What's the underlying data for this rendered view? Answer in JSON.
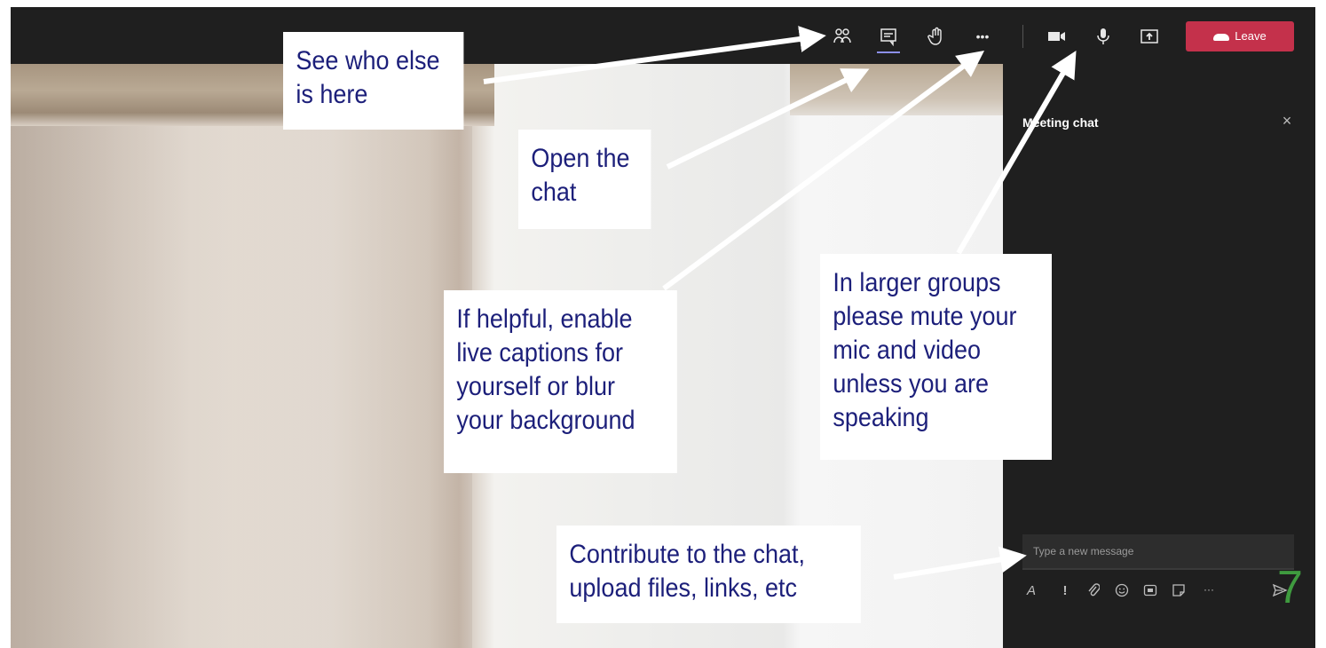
{
  "toolbar": {
    "icons": {
      "participants": "people-icon",
      "chat": "chat-icon",
      "raise_hand": "hand-icon",
      "more": "more-icon",
      "camera": "camera-icon",
      "microphone": "mic-icon",
      "share": "share-tray-icon"
    },
    "more_glyph": "•••",
    "leave_label": "Leave",
    "leave_color": "#c4314b",
    "active_underline_color": "#8c8fe8"
  },
  "chat_panel": {
    "title": "Meeting chat",
    "close_glyph": "×",
    "message_placeholder": "Type a new message",
    "composer_icons": [
      "format-icon",
      "important-icon",
      "attach-icon",
      "emoji-icon",
      "gif-icon",
      "sticker-icon",
      "more-icon",
      "send-icon"
    ],
    "more_glyph": "···"
  },
  "callouts": {
    "participants": "See who else\nis here",
    "chat": "Open the\nchat",
    "more": "If helpful, enable\nlive captions for\nyourself or blur\nyour background",
    "mute": "In larger groups\nplease mute your\nmic and video\nunless you are\nspeaking",
    "compose": "Contribute to the chat,\nupload files, links, etc"
  },
  "callout_text_color": "#1c1f7a",
  "page_number": "7",
  "page_number_color": "#3f9b3f"
}
